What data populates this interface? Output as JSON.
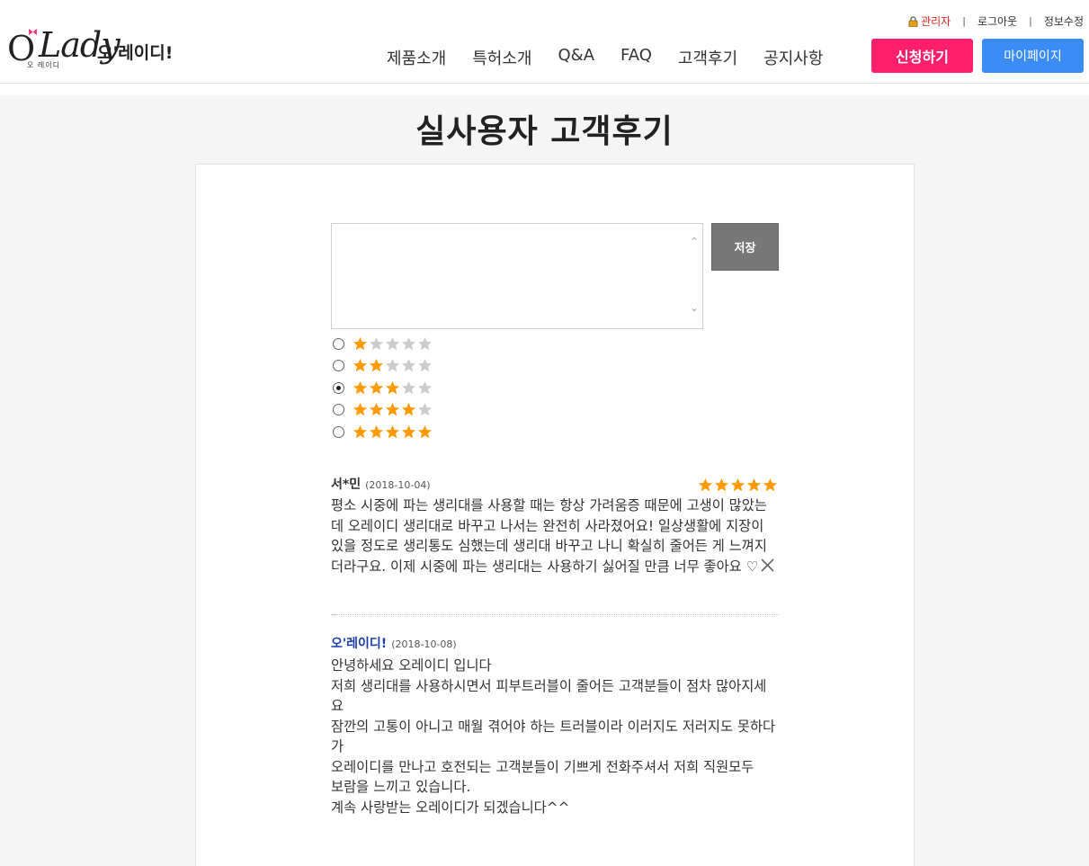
{
  "header": {
    "logo_main": "Lady",
    "logo_o": "O",
    "logo_apos": "'",
    "logo_sub": "오 레이디",
    "logo_korean": "오'레이디!",
    "util": {
      "admin": "관리자",
      "logout": "로그아웃",
      "edit_info": "정보수정",
      "sep": "|"
    },
    "nav": [
      "제품소개",
      "특허소개",
      "Q&A",
      "FAQ",
      "고객후기",
      "공지사항"
    ],
    "apply_label": "신청하기",
    "mypage_label": "마이페이지"
  },
  "page_title": "실사용자 고객후기",
  "form": {
    "save_label": "저장",
    "textarea_value": "",
    "ratings": [
      {
        "value": 1,
        "checked": false
      },
      {
        "value": 2,
        "checked": false
      },
      {
        "value": 3,
        "checked": true
      },
      {
        "value": 4,
        "checked": false
      },
      {
        "value": 5,
        "checked": false
      }
    ],
    "max_stars": 5
  },
  "review": {
    "author": "서*민",
    "date": "(2018-10-04)",
    "rating": 5,
    "body": "평소 시중에 파는 생리대를 사용할 때는 항상 가려움증 때문에 고생이 많았는데 오레이디 생리대로 바꾸고 나서는 완전히 사라졌어요! 일상생활에 지장이 있을 정도로 생리통도 심했는데 생리대 바꾸고 나니 확실히 줄어든 게 느껴지더라구요. 이제 시중에 파는 생리대는 사용하기 싫어질 만큼 너무 좋아요 ♡"
  },
  "reply": {
    "author": "오'레이디!",
    "date": "(2018-10-08)",
    "lines": [
      "안녕하세요 오레이디 입니다",
      "저희 생리대를 사용하시면서 피부트러블이 줄어든 고객분들이 점차 많아지세요",
      "잠깐의 고통이 아니고 매월 겪어야 하는 트러블이라 이러지도 저러지도 못하다가",
      "오레이디를 만나고 호전되는 고객분들이 기쁘게 전화주셔서 저희 직원모두",
      "보람을 느끼고 있습니다.",
      "계속 사랑받는 오레이디가 되겠습니다^^"
    ]
  },
  "colors": {
    "star_on": "#ff9a00",
    "star_off": "#cccccc",
    "apply_btn": "#ff1f6b",
    "mypage_btn": "#3b8cf7",
    "reply_author": "#1a3ea8",
    "admin": "#d9261c"
  }
}
